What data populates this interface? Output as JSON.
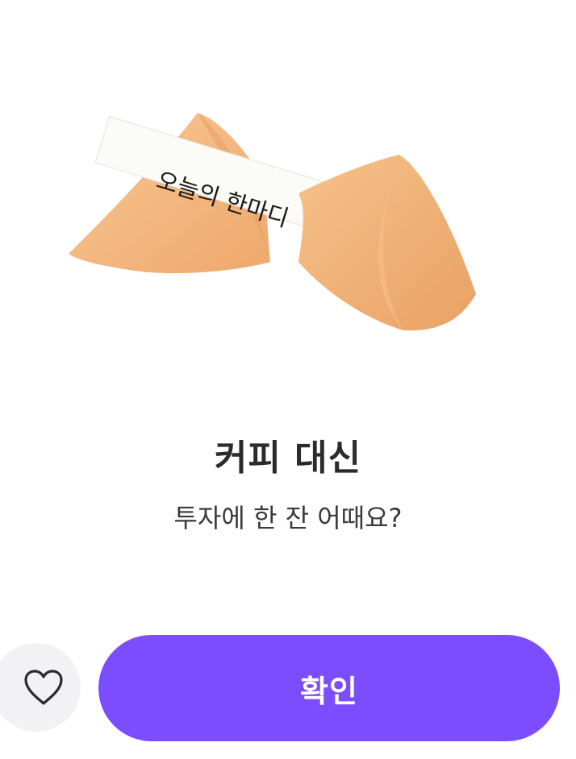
{
  "fortune": {
    "paper_text": "오늘의 한마디",
    "title": "커피 대신",
    "message": "투자에 한 잔 어때요?"
  },
  "actions": {
    "like_icon": "heart-outline-icon",
    "confirm_label": "확인"
  },
  "colors": {
    "primary": "#7c4dff",
    "like_bg": "#f2f2f4",
    "cookie": "#f2b27a"
  }
}
